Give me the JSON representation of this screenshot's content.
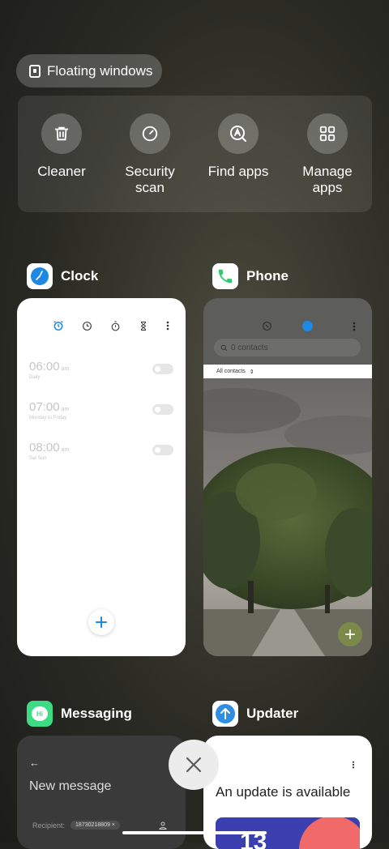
{
  "floating": {
    "label": "Floating windows"
  },
  "tools": [
    {
      "label": "Cleaner",
      "icon": "trash-icon"
    },
    {
      "label": "Security scan",
      "icon": "security-scan-icon"
    },
    {
      "label": "Find apps",
      "icon": "find-apps-icon"
    },
    {
      "label": "Manage apps",
      "icon": "grid-icon"
    }
  ],
  "apps": {
    "clock": {
      "name": "Clock",
      "alarms": [
        {
          "time": "06:00",
          "ampm": "am",
          "repeat": "Daily"
        },
        {
          "time": "07:00",
          "ampm": "am",
          "repeat": "Monday to Friday"
        },
        {
          "time": "08:00",
          "ampm": "am",
          "repeat": "Sat Sun"
        }
      ]
    },
    "phone": {
      "name": "Phone",
      "search_placeholder": "0 contacts",
      "filter": "All contacts"
    },
    "messaging": {
      "name": "Messaging",
      "icon_text": "Hi",
      "title": "New message",
      "recipient_label": "Recipient:",
      "recipient_value": "18730218809"
    },
    "updater": {
      "name": "Updater",
      "title": "An update is available"
    }
  },
  "colors": {
    "clock_accent": "#1e88e5",
    "phone_green": "#2ecc71",
    "messaging_green": "#3ddc84",
    "updater_blue": "#2f8de4",
    "fab_olive": "#7a8a4a"
  }
}
